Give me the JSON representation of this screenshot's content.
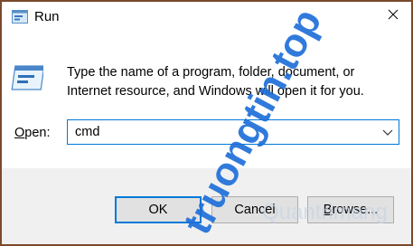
{
  "window": {
    "title": "Run",
    "title_icon": "run-icon",
    "close_icon": "close-icon"
  },
  "body": {
    "icon": "run-program-icon",
    "description": "Type the name of a program, folder, document, or Internet resource, and Windows will open it for you."
  },
  "open": {
    "label_prefix": "",
    "label_mnemonic": "O",
    "label_rest": "pen:",
    "value": "cmd",
    "dropdown_icon": "chevron-down-icon"
  },
  "buttons": {
    "ok": "OK",
    "cancel": "Cancel",
    "browse_prefix": "",
    "browse_mnemonic": "B",
    "browse_rest": "rowse..."
  },
  "watermark": {
    "primary": "truongtin.top",
    "secondary": "Quantrimang"
  },
  "colors": {
    "window_frame": "#7a4a2a",
    "accent": "#0078d7",
    "footer_bg": "#f0f0f0",
    "watermark": "#1e6fd9"
  }
}
